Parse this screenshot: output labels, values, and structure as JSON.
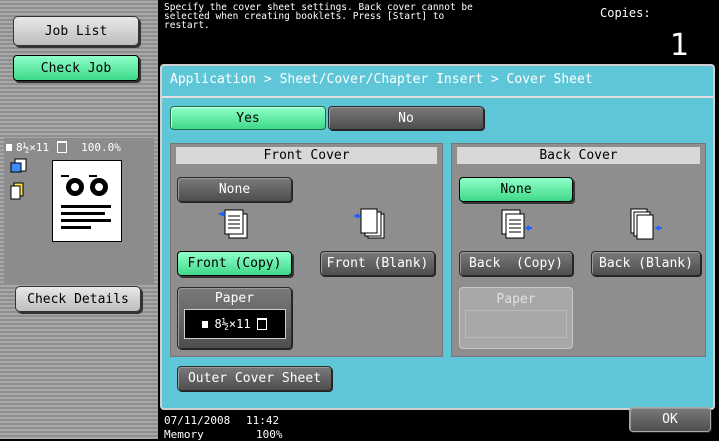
{
  "sidebar": {
    "job_list": "Job List",
    "check_job": "Check Job",
    "paper_info": "8½×11",
    "zoom": "100.0%",
    "check_details": "Check Details"
  },
  "header": {
    "message": "Specify the cover sheet settings. Back cover cannot be selected when creating booklets. Press [Start] to restart.",
    "copies_label": "Copies:",
    "copies_value": "1"
  },
  "breadcrumb": "Application > Sheet/Cover/Chapter Insert > Cover Sheet",
  "toggle": {
    "yes": "Yes",
    "no": "No",
    "selected": "Yes"
  },
  "front_cover": {
    "title": "Front Cover",
    "none": "None",
    "copy": "Front (Copy)",
    "blank": "Front (Blank)",
    "selected": "Front (Copy)",
    "paper_label": "Paper",
    "paper_value": "8½×11"
  },
  "back_cover": {
    "title": "Back Cover",
    "none": "None",
    "copy": "Back  (Copy)",
    "blank": "Back (Blank)",
    "selected": "None",
    "paper_label": "Paper"
  },
  "outer_cover_sheet": "Outer Cover Sheet",
  "footer": {
    "date": "07/11/2008",
    "time": "11:42",
    "memory_label": "Memory",
    "memory_value": "100%",
    "ok": "OK"
  },
  "colors": {
    "selected_green": "#5ef0a8",
    "panel_cyan": "#5fc6d8",
    "status_bar": "#000000"
  }
}
